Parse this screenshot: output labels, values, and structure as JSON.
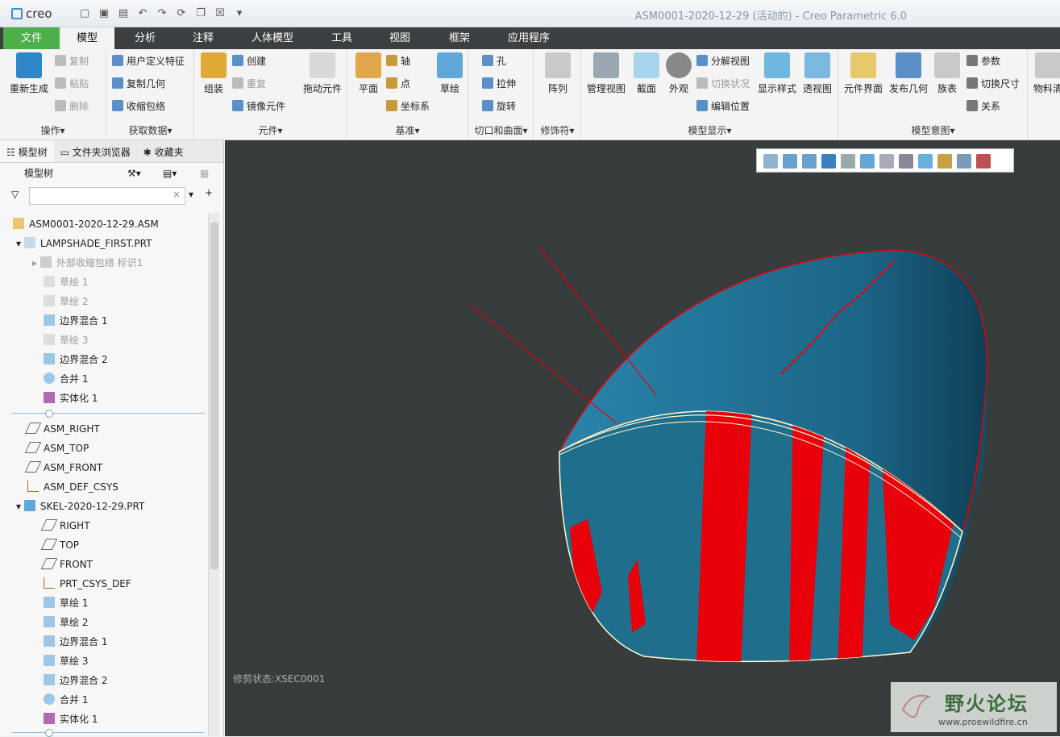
{
  "titlebar": {
    "logo": "creo",
    "window_title": "ASM0001-2020-12-29 (活动的) - Creo Parametric 6.0"
  },
  "tabs": [
    "文件",
    "模型",
    "分析",
    "注释",
    "人体模型",
    "工具",
    "视图",
    "框架",
    "应用程序"
  ],
  "ribbon": {
    "operations": {
      "regenerate": "重新生成",
      "copy": "复制",
      "paste": "粘贴",
      "delete": "删除",
      "label": "操作▾"
    },
    "get_data": {
      "udf": "用户定义特征",
      "copy_geom": "复制几何",
      "shrinkwrap": "收缩包络",
      "label": "获取数据▾"
    },
    "component": {
      "assemble": "组装",
      "create": "创建",
      "repeat": "重复",
      "mirror": "镜像元件",
      "drag": "拖动元件",
      "label": "元件▾"
    },
    "datum": {
      "plane": "平面",
      "axis": "轴",
      "point": "点",
      "csys": "坐标系",
      "sketch": "草绘",
      "label": "基准▾"
    },
    "cut_surface": {
      "hole": "孔",
      "extrude": "拉伸",
      "revolve": "旋转",
      "label": "切口和曲面▾"
    },
    "modifier": {
      "pattern": "阵列",
      "label": "修饰符▾"
    },
    "model_display": {
      "manage_views": "管理视图",
      "section": "截面",
      "appearance": "外观",
      "explode": "分解视图",
      "toggle": "切换状况",
      "edit_pos": "编辑位置",
      "display_style": "显示样式",
      "perspective": "透视图",
      "label": "模型显示▾"
    },
    "model_intent": {
      "comp_interface": "元件界面",
      "publish_geom": "发布几何",
      "family_table": "族表",
      "params": "参数",
      "switch_dims": "切换尺寸",
      "relations": "关系",
      "label": "模型意图▾"
    },
    "bom": "物料清"
  },
  "sidebar": {
    "tabs": [
      "模型树",
      "文件夹浏览器",
      "收藏夹"
    ],
    "tree_title": "模型树",
    "filter_placeholder": "",
    "nodes": [
      "ASM0001-2020-12-29.ASM",
      "LAMPSHADE_FIRST.PRT",
      "外部收缩包络 标识1",
      "草绘 1",
      "草绘 2",
      "边界混合 1",
      "草绘 3",
      "边界混合 2",
      "合并 1",
      "实体化 1",
      "ASM_RIGHT",
      "ASM_TOP",
      "ASM_FRONT",
      "ASM_DEF_CSYS",
      "SKEL-2020-12-29.PRT",
      "RIGHT",
      "TOP",
      "FRONT",
      "PRT_CSYS_DEF",
      "草绘 1",
      "草绘 2",
      "边界混合 1",
      "草绘 3",
      "边界混合 2",
      "合并 1",
      "实体化 1"
    ]
  },
  "viewport": {
    "status": "修剪状态:XSEC0001",
    "watermark_title": "野火论坛",
    "watermark_url": "www.proewildfire.cn"
  },
  "colors": {
    "accent": "#4caf4a",
    "surface": "#1f6e8c",
    "interference": "#e8000b",
    "background": "#373c3d"
  }
}
